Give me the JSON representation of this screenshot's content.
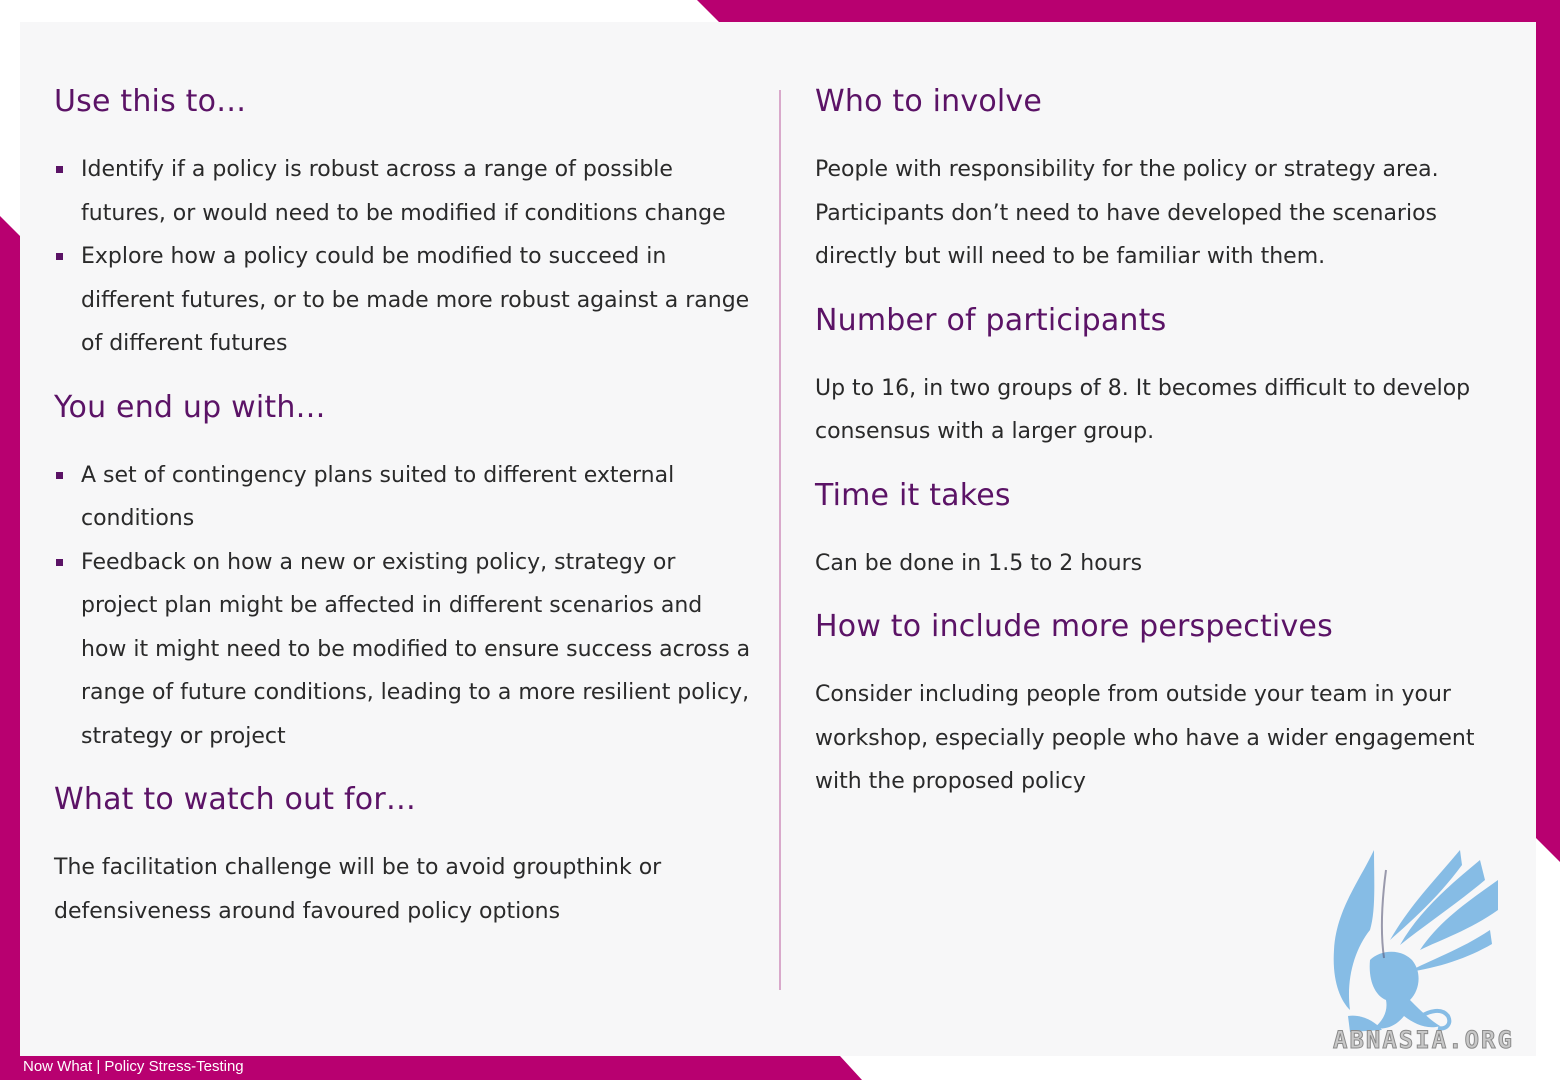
{
  "left": {
    "use_this_to": {
      "heading": "Use this to…",
      "items": [
        "Identify if a policy is robust across a range of possible futures, or would need to be modified if conditions change",
        "Explore how a policy could be modified to succeed in different futures, or to be made more robust against a range of different futures"
      ]
    },
    "end_up_with": {
      "heading": "You end up with…",
      "items": [
        "A set of contingency plans suited to different external conditions",
        "Feedback on how a new or existing policy, strategy or project plan might be affected in different scenarios and how it might need to be modified to ensure success across a range of future conditions, leading to a more resilient policy, strategy or project"
      ]
    },
    "watch_out": {
      "heading": "What to watch out for…",
      "text": "The facilitation challenge will be to avoid groupthink or defensiveness around favoured policy options"
    }
  },
  "right": {
    "who": {
      "heading": "Who to involve",
      "text": "People with responsibility for the policy or strategy area. Participants don’t need to have developed the scenarios directly but will need to be familiar with them."
    },
    "number": {
      "heading": "Number of participants",
      "text": "Up to 16, in two groups of 8. It becomes difficult to develop consensus with a larger group."
    },
    "time": {
      "heading": "Time it takes",
      "text": "Can be done in 1.5 to 2 hours"
    },
    "perspectives": {
      "heading": "How to include more perspectives",
      "text": "Consider including people from outside your team in your workshop, especially people who have a wider engagement with the proposed policy"
    }
  },
  "footer": {
    "text": "Now What | Policy Stress-Testing"
  },
  "watermark": {
    "text": "ABNASIA.ORG",
    "icon": "griffin-logo-icon"
  },
  "colors": {
    "frame": "#b80070",
    "heading": "#5b1366",
    "divider": "#d9a9cb"
  }
}
